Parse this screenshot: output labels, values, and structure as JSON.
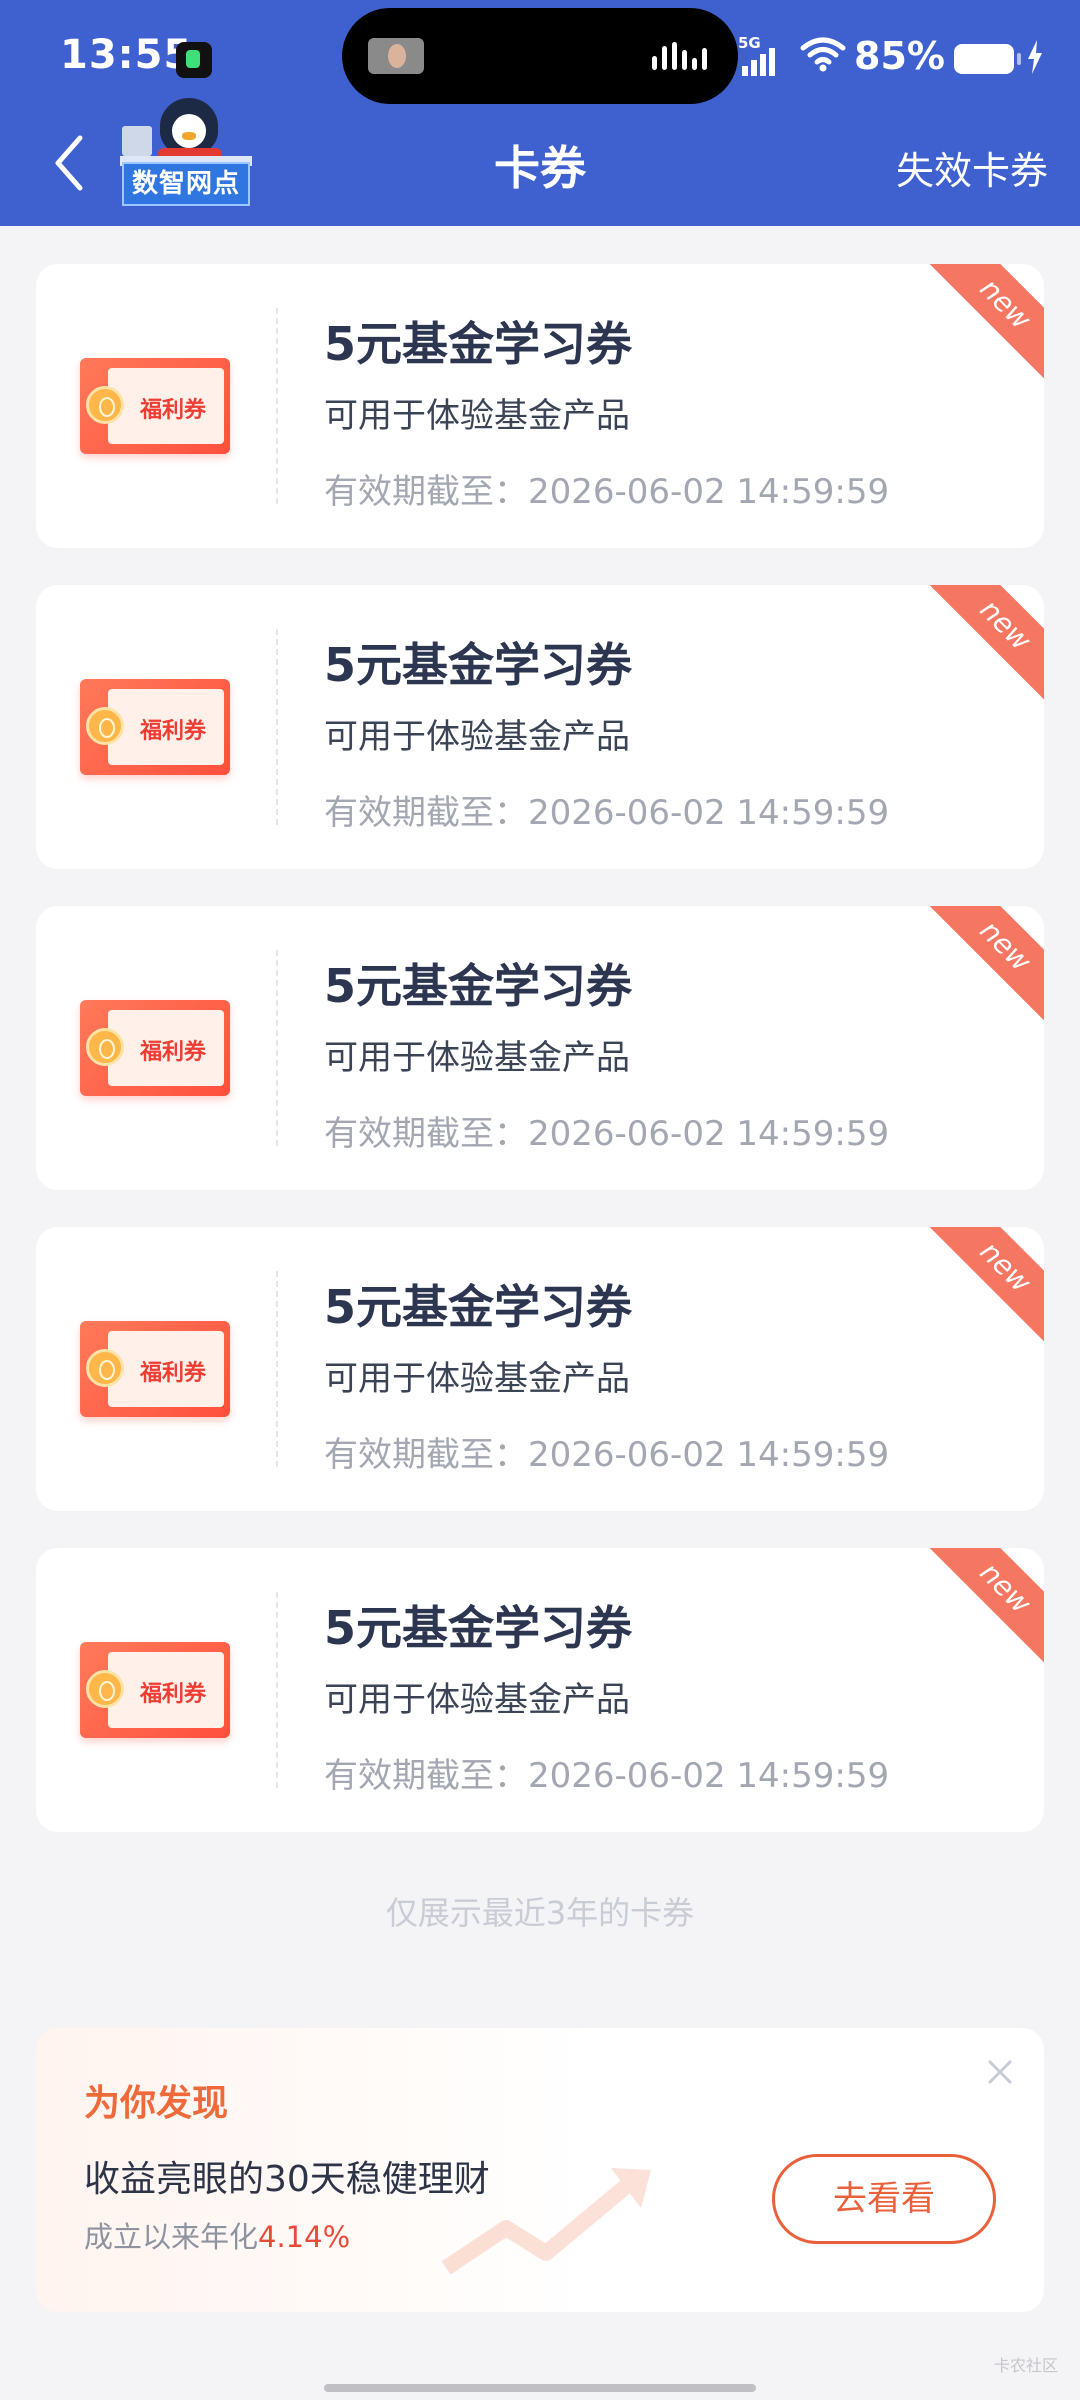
{
  "status_bar": {
    "time": "13:55",
    "network": "5G",
    "battery_percent": "85%"
  },
  "nav": {
    "logo_text": "数智网点",
    "title": "卡券",
    "expired_link": "失效卡券"
  },
  "coupons": [
    {
      "art_label": "福利券",
      "title": "5元基金学习券",
      "description": "可用于体验基金产品",
      "expiry": "有效期截至：2026-06-02 14:59:59",
      "badge": "new"
    },
    {
      "art_label": "福利券",
      "title": "5元基金学习券",
      "description": "可用于体验基金产品",
      "expiry": "有效期截至：2026-06-02 14:59:59",
      "badge": "new"
    },
    {
      "art_label": "福利券",
      "title": "5元基金学习券",
      "description": "可用于体验基金产品",
      "expiry": "有效期截至：2026-06-02 14:59:59",
      "badge": "new"
    },
    {
      "art_label": "福利券",
      "title": "5元基金学习券",
      "description": "可用于体验基金产品",
      "expiry": "有效期截至：2026-06-02 14:59:59",
      "badge": "new"
    },
    {
      "art_label": "福利券",
      "title": "5元基金学习券",
      "description": "可用于体验基金产品",
      "expiry": "有效期截至：2026-06-02 14:59:59",
      "badge": "new"
    }
  ],
  "list_footer": "仅展示最近3年的卡券",
  "promo": {
    "heading": "为你发现",
    "product": "收益亮眼的30天稳健理财",
    "rate_label": "成立以来年化",
    "rate_value": "4.14%",
    "button": "去看看"
  },
  "watermark": "卡农社区",
  "icons": {
    "back": "chevron-left-icon",
    "close": "close-icon",
    "wifi": "wifi-icon",
    "battery": "battery-icon",
    "charge": "lightning-icon"
  },
  "colors": {
    "header_bg": "#3f61cf",
    "ribbon": "#f57661",
    "accent_orange": "#e9613b",
    "rate_red": "#e84a38"
  }
}
